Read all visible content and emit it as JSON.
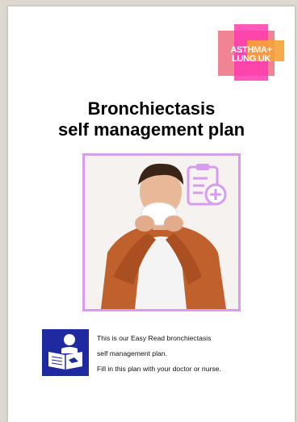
{
  "logo": {
    "line1": "ASTHMA+",
    "line2": "LUNG UK"
  },
  "title": {
    "line1": "Bronchiectasis",
    "line2": "self management plan"
  },
  "intro": {
    "line1": "This is our Easy Read bronchiectasis",
    "line2": "self management plan.",
    "line3": "Fill in this plan with your doctor or nurse."
  },
  "icons": {
    "photo": "man-coughing-into-tissue-image",
    "clipboard": "clipboard-plus-icon",
    "easy_read": "easy-read-reading-icon"
  },
  "colors": {
    "frame": "#d79cf0",
    "easy_read_bg": "#1f2aa0",
    "logo_pink": "#ff3ab0",
    "logo_orange": "#f6a23a"
  }
}
